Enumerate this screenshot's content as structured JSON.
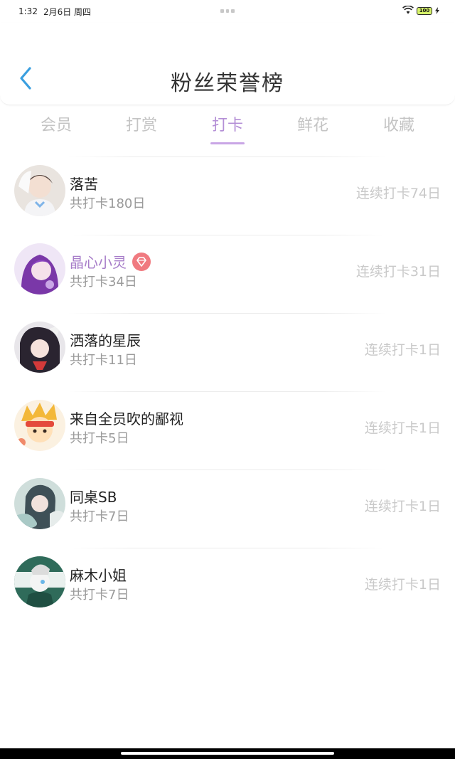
{
  "status_bar": {
    "time": "1:32",
    "date": "2月6日 周四",
    "battery": "100"
  },
  "header": {
    "title": "粉丝荣誉榜"
  },
  "tabs": [
    {
      "label": "会员",
      "active": false
    },
    {
      "label": "打赏",
      "active": false
    },
    {
      "label": "打卡",
      "active": true
    },
    {
      "label": "鲜花",
      "active": false
    },
    {
      "label": "收藏",
      "active": false
    }
  ],
  "ranking": [
    {
      "name": "落苦",
      "total": "共打卡180日",
      "streak": "连续打卡74日",
      "vip": false
    },
    {
      "name": "晶心小灵",
      "total": "共打卡34日",
      "streak": "连续打卡31日",
      "vip": true
    },
    {
      "name": "洒落的星辰",
      "total": "共打卡11日",
      "streak": "连续打卡1日",
      "vip": false
    },
    {
      "name": "来自全员吹的鄙视",
      "total": "共打卡5日",
      "streak": "连续打卡1日",
      "vip": false
    },
    {
      "name": "同桌SB",
      "total": "共打卡7日",
      "streak": "连续打卡1日",
      "vip": false
    },
    {
      "name": "麻木小姐",
      "total": "共打卡7日",
      "streak": "连续打卡1日",
      "vip": false
    }
  ],
  "colors": {
    "accent": "#b48fd6",
    "vip_name": "#a77dc9",
    "gem_badge": "#f07a80",
    "back_arrow": "#3a9fe0"
  },
  "icons": {
    "back": "chevron-left-icon",
    "vip_badge": "diamond-icon",
    "wifi": "wifi-icon",
    "battery": "battery-icon"
  }
}
